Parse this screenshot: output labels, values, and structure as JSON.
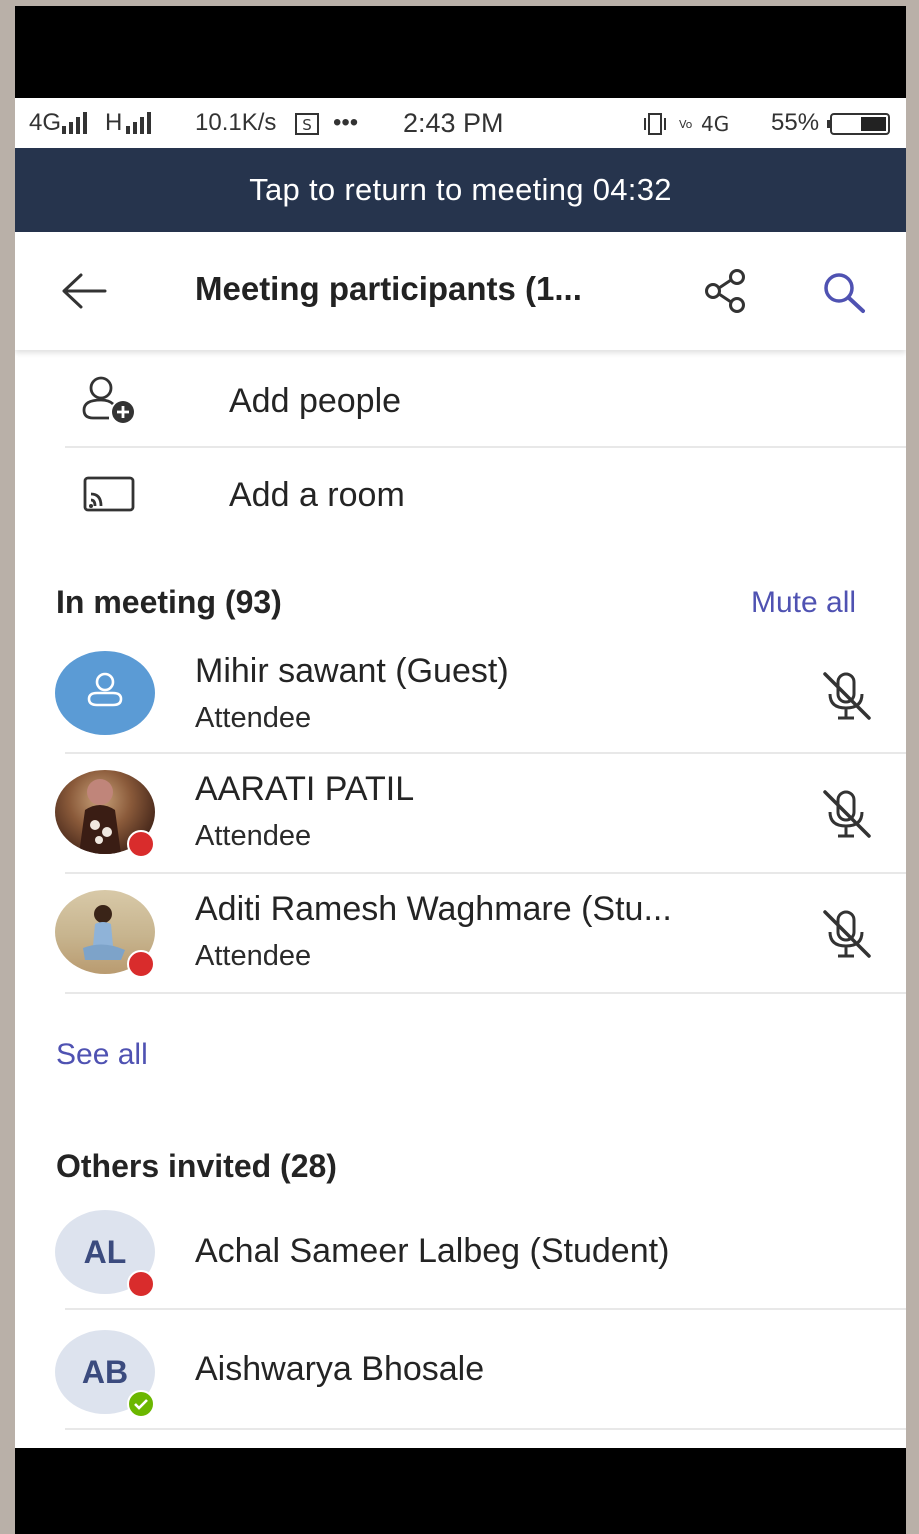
{
  "status_bar": {
    "network_left": "4G",
    "network_mid": "H",
    "speed": "10.1K/s",
    "more": "•••",
    "time": "2:43 PM",
    "battery": "55%"
  },
  "banner": {
    "text": "Tap to return to meeting 04:32"
  },
  "header": {
    "title": "Meeting participants (1...",
    "back_icon": "arrow-left-icon",
    "share_icon": "share-icon",
    "search_icon": "search-icon"
  },
  "actions": [
    {
      "label": "Add people",
      "icon": "add-person-icon"
    },
    {
      "label": "Add a room",
      "icon": "cast-room-icon"
    }
  ],
  "in_meeting": {
    "title": "In meeting (93)",
    "mute_all": "Mute all",
    "see_all": "See all",
    "participants": [
      {
        "name": "Mihir sawant (Guest)",
        "role": "Attendee",
        "avatar": "guest",
        "mic": "mic-off-icon"
      },
      {
        "name": "AARATI PATIL",
        "role": "Attendee",
        "avatar": "photo",
        "presence": "busy",
        "mic": "mic-off-icon"
      },
      {
        "name": "Aditi Ramesh Waghmare (Stu...",
        "role": "Attendee",
        "avatar": "photo",
        "presence": "busy",
        "mic": "mic-off-icon"
      }
    ]
  },
  "others_invited": {
    "title": "Others invited (28)",
    "people": [
      {
        "name": "Achal Sameer Lalbeg (Student)",
        "initials": "AL",
        "presence": "busy"
      },
      {
        "name": "Aishwarya Bhosale",
        "initials": "AB",
        "presence": "available"
      }
    ]
  },
  "colors": {
    "banner_bg": "#26344d",
    "accent": "#4f52b2",
    "busy": "#d92c2c",
    "available": "#6bb700",
    "guest_avatar": "#5b9bd5",
    "initials_bg": "#dde3ee"
  }
}
